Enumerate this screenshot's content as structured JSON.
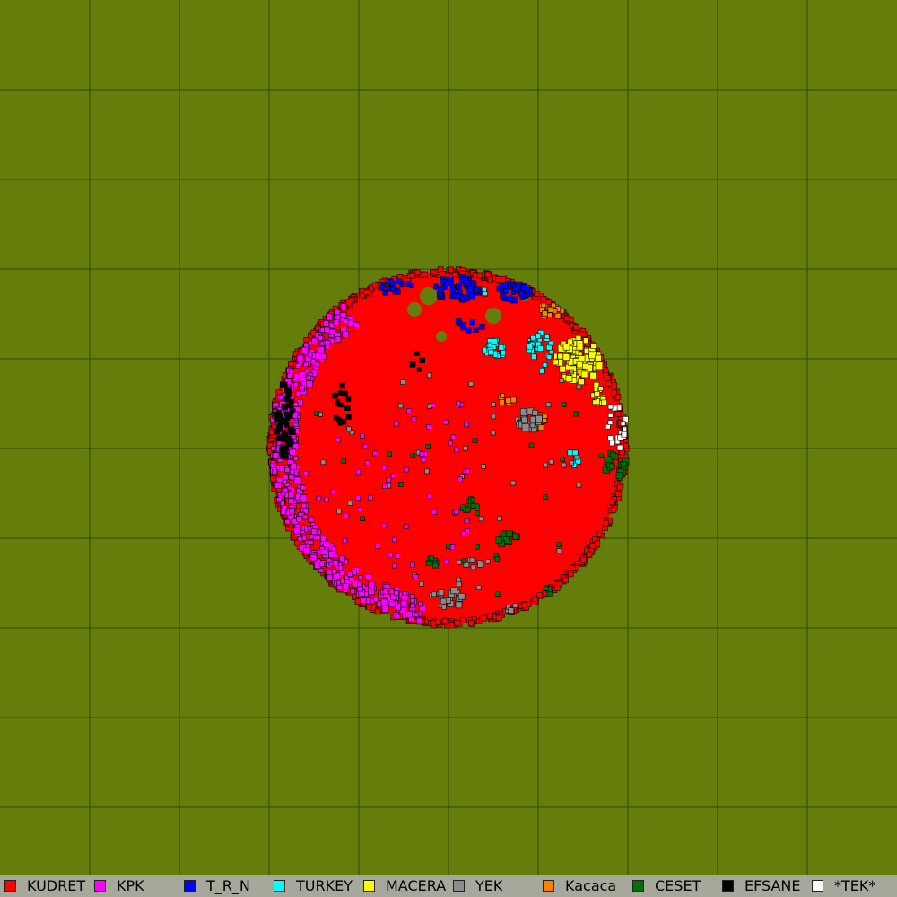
{
  "map": {
    "background_color": "#657d0b",
    "grid_color": "#2f4a08",
    "grid_cells": 10,
    "dominant_tribe_color": "#ff0000"
  },
  "legend": {
    "items": [
      {
        "label": "KUDRET",
        "color": "#ff0000"
      },
      {
        "label": "KPK",
        "color": "#ff00ff"
      },
      {
        "label": "T_R_N",
        "color": "#0000ff"
      },
      {
        "label": "TURKEY",
        "color": "#00ffff"
      },
      {
        "label": "MACERA",
        "color": "#ffff00"
      },
      {
        "label": "YEK",
        "color": "#8c8c8c"
      },
      {
        "label": "Kacaca",
        "color": "#ff8000"
      },
      {
        "label": "CESET",
        "color": "#007000"
      },
      {
        "label": "EFSANE",
        "color": "#000000"
      },
      {
        "label": "*TEK*",
        "color": "#ffffff"
      }
    ]
  }
}
